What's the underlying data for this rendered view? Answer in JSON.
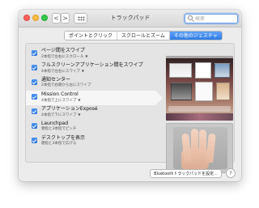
{
  "window": {
    "title": "トラックパッド",
    "search_placeholder": "検索",
    "nav_back": "<",
    "nav_forward": ">"
  },
  "tabs": [
    {
      "label": "ポイントとクリック",
      "active": false
    },
    {
      "label": "スクロールとズーム",
      "active": false
    },
    {
      "label": "その他のジェスチャ",
      "active": true
    }
  ],
  "gestures": [
    {
      "title": "ページ間をスワイプ",
      "subtitle": "2本指で左右にスクロール",
      "has_menu": true,
      "checked": true
    },
    {
      "title": "フルスクリーンアプリケーション間をスワイプ",
      "subtitle": "4本指で左右にスワイプ",
      "has_menu": true,
      "checked": true
    },
    {
      "title": "通知センター",
      "subtitle": "2本指で右端から左にスワイプ",
      "has_menu": false,
      "checked": true
    },
    {
      "title": "Mission Control",
      "subtitle": "4本指で上にスワイプ",
      "has_menu": true,
      "checked": true
    },
    {
      "title": "アプリケーションExposé",
      "subtitle": "4本指で下にスワイプ",
      "has_menu": true,
      "checked": true
    },
    {
      "title": "Launchpad",
      "subtitle": "親指と3本指でピンチ",
      "has_menu": false,
      "checked": true
    },
    {
      "title": "デスクトップを表示",
      "subtitle": "親指と3本指で広げる",
      "has_menu": false,
      "checked": true
    }
  ],
  "selected_gesture_index": 3,
  "buttons": {
    "bluetooth": "Bluetoothトラックパッドを設定...",
    "help": "?"
  },
  "colors": {
    "accent": "#2f7ce6",
    "checkbox": "#3a84ee"
  }
}
